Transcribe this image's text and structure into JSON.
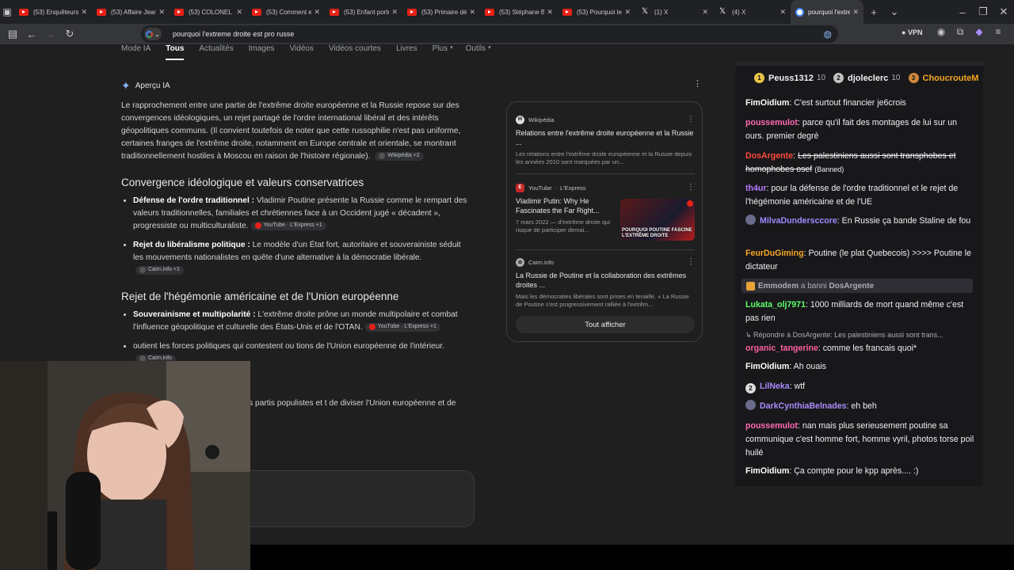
{
  "tabs": [
    {
      "label": "(53) Enquêteurs d",
      "icon": "youtube-icon"
    },
    {
      "label": "(53) Affaire Jean",
      "icon": "youtube-icon"
    },
    {
      "label": "(53) COLONEL RE",
      "icon": "youtube-icon"
    },
    {
      "label": "(53) Comment et",
      "icon": "youtube-icon"
    },
    {
      "label": "(53) Enfant porté",
      "icon": "youtube-icon"
    },
    {
      "label": "(53) Primaire dém",
      "icon": "youtube-icon"
    },
    {
      "label": "(53) Stéphane Bo",
      "icon": "youtube-icon"
    },
    {
      "label": "(53) Pourquoi le L",
      "icon": "youtube-icon"
    },
    {
      "label": "(1) X",
      "icon": "x-icon"
    },
    {
      "label": "(4) X",
      "icon": "x-icon"
    },
    {
      "label": "pourquoi l'extrem",
      "icon": "google-icon",
      "active": true
    }
  ],
  "toolbar": {
    "url": "pourquoi l'extreme droite est pro russe",
    "vpn": "VPN"
  },
  "nav": {
    "items": [
      "Mode IA",
      "Tous",
      "Actualités",
      "Images",
      "Vidéos",
      "Vidéos courtes",
      "Livres",
      "Plus",
      "Outils"
    ],
    "active": "Tous"
  },
  "overview": {
    "heading": "Aperçu IA",
    "intro": "Le rapprochement entre une partie de l'extrême droite européenne et la Russie repose sur des convergences idéologiques, un rejet partagé de l'ordre international libéral et des intérêts géopolitiques communs. (Il convient toutefois de noter que cette russophilie n'est pas uniforme, certaines franges de l'extrême droite, notamment en Europe centrale et orientale, se montrant traditionnellement hostiles à Moscou en raison de l'histoire régionale).",
    "intro_chip": "Wikipédia +2",
    "sections": [
      {
        "title": "Convergence idéologique et valeurs conservatrices",
        "bullets": [
          {
            "bold": "Défense de l'ordre traditionnel :",
            "text": " Vladimir Poutine présente la Russie comme le rempart des valeurs traditionnelles, familiales et chrétiennes face à un Occident jugé « décadent », progressiste ou multiculturaliste.",
            "chip": "YouTube · L'Express +1"
          },
          {
            "bold": "Rejet du libéralisme politique :",
            "text": " Le modèle d'un État fort, autoritaire et souverainiste séduit les mouvements nationalistes en quête d'une alternative à la démocratie libérale.",
            "chip": "Cairn.info +1"
          }
        ]
      },
      {
        "title": "Rejet de l'hégémonie américaine et de l'Union européenne",
        "bullets": [
          {
            "bold": "Souverainisme et multipolarité :",
            "text": " L'extrême droite prône un monde multipolaire et combat l'influence géopolitique et culturelle des États-Unis et de l'OTAN.",
            "chip": "YouTube · L'Express +1"
          },
          {
            "bold": "",
            "text": "outient les forces politiques qui contestent ou tions de l'Union européenne de l'intérieur.",
            "chip": "Cairn.info"
          }
        ]
      },
      {
        "title": "nanciers",
        "bullets": [
          {
            "bold": "els :",
            "text": " Pour le Kremlin, appuyer les partis populistes et t de diviser l'Union européenne et de légitimer sa",
            "chip": ""
          }
        ]
      }
    ]
  },
  "sources": {
    "items": [
      {
        "site": "Wikipédia",
        "title": "Relations entre l'extrême droite européenne et la Russie ...",
        "desc": "Les relations entre l'extrême droite européenne et la Russie depuis les années 2010 sont marquées par un..."
      },
      {
        "site": "YouTube",
        "sub": "L'Express",
        "title": "Vladimir Putin: Why He Fascinates the Far Right...",
        "desc": "7 mars 2022 — d'extrême droite qui risque de participer demai...",
        "thumb_text": "POURQUOI POUTINE FASCINE L'EXTRÊME DROITE"
      },
      {
        "site": "Cairn.info",
        "title": "La Russie de Poutine et la collaboration des extrêmes droites ...",
        "desc": "Mais les démocraties libérales sont prises en tenaille. « La Russie de Poutine s'est progressivement ralliée à l'extrêm..."
      }
    ],
    "show_all": "Tout afficher"
  },
  "chat": {
    "leaders": [
      {
        "rank": "1",
        "name": "Peuss1312",
        "count": "10",
        "color": "#e8c547"
      },
      {
        "rank": "2",
        "name": "djoleclerc",
        "count": "10",
        "color": "#c0c0c0"
      },
      {
        "rank": "3",
        "name": "ChoucrouteM",
        "count": "",
        "color": "#d08a3b"
      }
    ],
    "messages": [
      {
        "user": "FimOidium",
        "color": "#ffffff",
        "text": "C'est surtout financier je6crois"
      },
      {
        "user": "poussemulot",
        "color": "#ff69b4",
        "text": "parce qu'il fait des montages de lui sur un ours. premier degré"
      },
      {
        "user": "DosArgente",
        "color": "#ff4a3d",
        "text": "Les palestiniens aussi sont transphobes et homophobes osef",
        "banned": "(Banned)"
      },
      {
        "user": "th4ur",
        "color": "#b57bff",
        "text": "pour la défense de l'ordre traditionnel et le rejet de l'hégémonie américaine et de l'UE"
      },
      {
        "user": "MilvaDundersccore",
        "color": "#9b8cff",
        "text": "En Russie ça bande Staline de fou"
      },
      {
        "user": "FeurDuGiming",
        "color": "#f5a623",
        "text": "Poutine (le plat Quebecois) >>>> Poutine le dictateur"
      },
      {
        "user": "Lukata_olj7971",
        "color": "#5cff6a",
        "text": "1000 milliards de mort quand même c'est pas rien"
      },
      {
        "user": "organic_tangerine",
        "color": "#ff5fa2",
        "text": "comme les francais quoi*"
      },
      {
        "user": "FimOidium",
        "color": "#ffffff",
        "text": "Ah ouais"
      },
      {
        "user": "LilNeka",
        "color": "#a78bfa",
        "text": "wtf",
        "badge": "2"
      },
      {
        "user": "DarkCynthiaBelnades",
        "color": "#a78bfa",
        "text": "eh beh"
      },
      {
        "user": "poussemulot",
        "color": "#ff69b4",
        "text": "nan mais plus serieusement poutine sa communique c'est homme fort, homme vyril, photos torse poil huilé"
      },
      {
        "user": "FimOidium",
        "color": "#ffffff",
        "text": "Ça compte pour le kpp après.... :)"
      }
    ],
    "mod_note": {
      "mod": "Emmodem",
      "action": "a banni",
      "target": "DosArgente"
    },
    "reply": "Répondre à DosArgente: Les palestiniens aussi sont trans..."
  },
  "colors": {
    "accent": "#8ab4f8",
    "youtube": "#e62117",
    "chat_bg": "#18181b"
  }
}
